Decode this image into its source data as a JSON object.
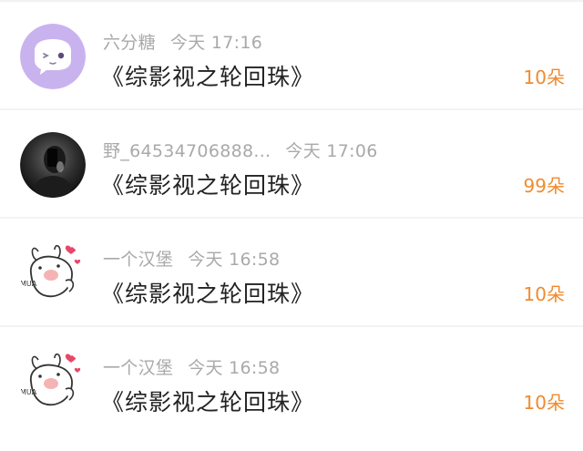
{
  "rows": [
    {
      "username": "六分糖",
      "time": "今天 17:16",
      "title": "《综影视之轮回珠》",
      "gift": "10朵",
      "avatar": "purple-chat-bubble-avatar"
    },
    {
      "username": "野_64534706888...",
      "time": "今天 17:06",
      "title": "《综影视之轮回珠》",
      "gift": "99朵",
      "avatar": "dark-selfie-avatar"
    },
    {
      "username": "一个汉堡",
      "time": "今天 16:58",
      "title": "《综影视之轮回珠》",
      "gift": "10朵",
      "avatar": "cartoon-rabbit-avatar",
      "avatar_text": "MUA"
    },
    {
      "username": "一个汉堡",
      "time": "今天 16:58",
      "title": "《综影视之轮回珠》",
      "gift": "10朵",
      "avatar": "cartoon-rabbit-avatar",
      "avatar_text": "MUA"
    }
  ],
  "colors": {
    "gift": "#f08a2e",
    "meta": "#a9a9a9",
    "title": "#222222",
    "avatar_purple": "#c9b3ee"
  }
}
